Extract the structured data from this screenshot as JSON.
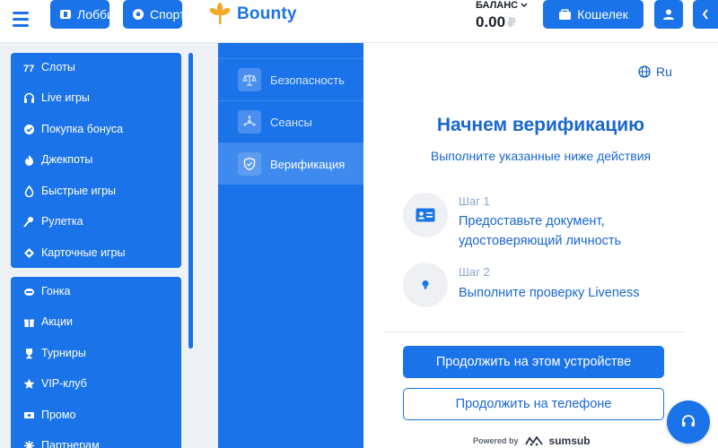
{
  "header": {
    "lobby_label": "Лобби",
    "sport_label": "Спорт",
    "logo_text": "Bounty",
    "balance_label": "БАЛАНС",
    "balance_value": "0.00",
    "currency_symbol": "₽",
    "wallet_label": "Кошелек"
  },
  "sidebar": {
    "group1": [
      {
        "label": "Слоты",
        "icon": "slots-icon"
      },
      {
        "label": "Live игры",
        "icon": "headphones-icon"
      },
      {
        "label": "Покупка бонуса",
        "icon": "bonus-icon"
      },
      {
        "label": "Джекпоты",
        "icon": "fire-icon"
      },
      {
        "label": "Быстрые игры",
        "icon": "flame-icon"
      },
      {
        "label": "Рулетка",
        "icon": "roulette-icon"
      },
      {
        "label": "Карточные игры",
        "icon": "cards-icon"
      }
    ],
    "group2": [
      {
        "label": "Гонка",
        "icon": "race-icon"
      },
      {
        "label": "Акции",
        "icon": "gift-icon"
      },
      {
        "label": "Турниры",
        "icon": "trophy-icon"
      },
      {
        "label": "VIP-клуб",
        "icon": "star-icon"
      },
      {
        "label": "Промо",
        "icon": "promo-icon"
      },
      {
        "label": "Партнерам",
        "icon": "partners-icon"
      }
    ]
  },
  "settings_nav": [
    {
      "label": "Безопасность",
      "icon": "scales-icon"
    },
    {
      "label": "Сеансы",
      "icon": "sessions-icon"
    },
    {
      "label": "Верификация",
      "icon": "shield-check-icon",
      "active": true
    }
  ],
  "verification": {
    "language": "Ru",
    "title": "Начнем верификацию",
    "subtitle": "Выполните указанные ниже действия",
    "step1_label": "Шаг 1",
    "step1_text": "Предоставьте документ, удостоверяющий личность",
    "step2_label": "Шаг 2",
    "step2_text": "Выполните проверку Liveness",
    "continue_device": "Продолжить на этом устройстве",
    "continue_phone": "Продолжить на телефоне",
    "powered_by": "Powered by",
    "brand": "sumsub"
  },
  "colors": {
    "primary": "#1a73e8",
    "text_blue": "#1967d2",
    "background": "#eef1f6"
  }
}
